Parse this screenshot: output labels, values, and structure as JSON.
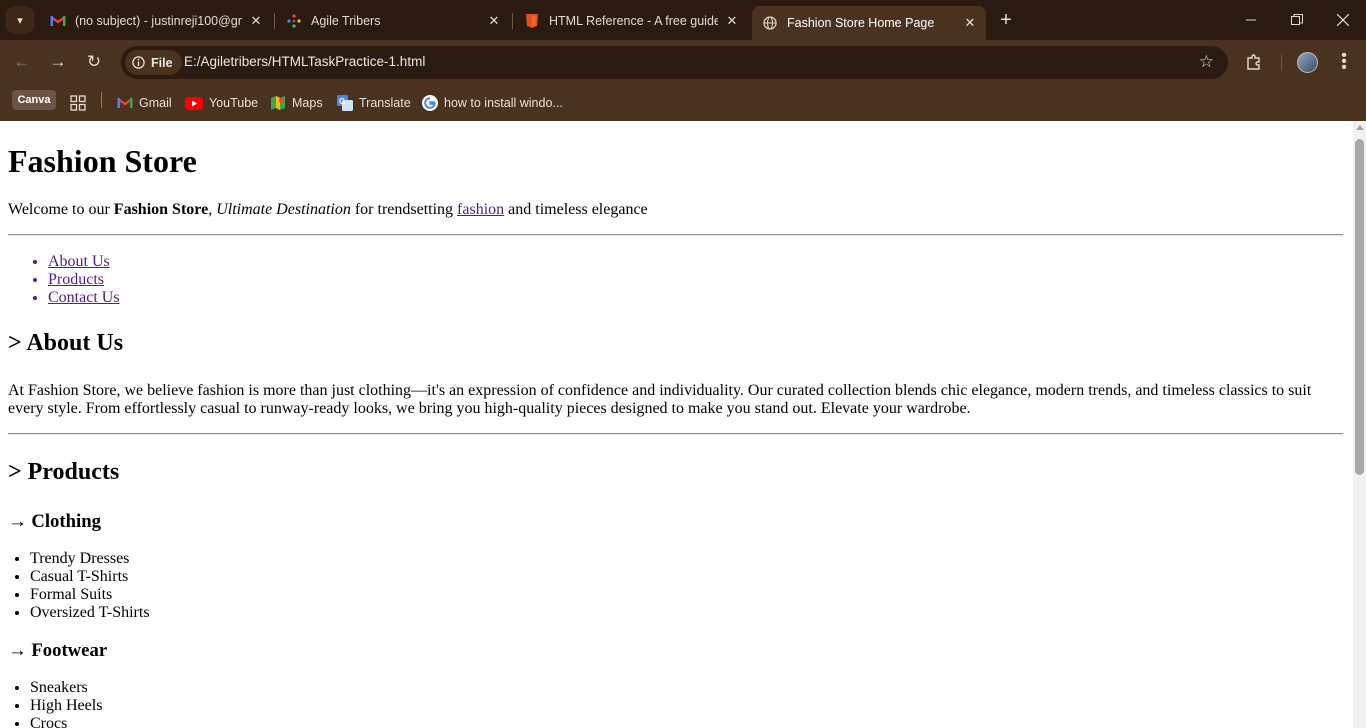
{
  "browser": {
    "tabs": [
      {
        "title": "(no subject) - justinreji100@gm",
        "icon": "gmail-icon"
      },
      {
        "title": "Agile Tribers",
        "icon": "agile-tribers-icon"
      },
      {
        "title": "HTML Reference - A free guide",
        "icon": "html-reference-icon"
      },
      {
        "title": "Fashion Store Home Page",
        "icon": "globe-icon"
      }
    ],
    "active_tab": 3,
    "address": {
      "chip_label": "File",
      "url": "E:/Agiletribers/HTMLTaskPractice-1.html"
    },
    "bookmarks": [
      {
        "label": "Canva"
      },
      {
        "label": "Gmail"
      },
      {
        "label": "YouTube"
      },
      {
        "label": "Maps"
      },
      {
        "label": "Translate"
      },
      {
        "label": "how to install windo..."
      }
    ],
    "colors": {
      "chrome_dark": "#2b1a0f",
      "chrome_mid": "#4a3220"
    }
  },
  "page": {
    "title": "Fashion Store",
    "intro": {
      "pre": "Welcome to our ",
      "bold": "Fashion Store",
      "comma": ", ",
      "italic": "Ultimate Destination",
      "mid": " for trendsetting ",
      "link": "fashion",
      "post": " and timeless elegance"
    },
    "nav": [
      "About Us",
      "Products",
      "Contact Us"
    ],
    "about": {
      "heading": "> About Us",
      "text": "At Fashion Store, we believe fashion is more than just clothing—it's an expression of confidence and individuality. Our curated collection blends chic elegance, modern trends, and timeless classics to suit every style. From effortlessly casual to runway-ready looks, we bring you high-quality pieces designed to make you stand out. Elevate your wardrobe."
    },
    "products": {
      "heading": "> Products",
      "categories": [
        {
          "title": "→ Clothing",
          "items": [
            "Trendy Dresses",
            "Casual T-Shirts",
            "Formal Suits",
            "Oversized T-Shirts"
          ]
        },
        {
          "title": "→ Footwear",
          "items": [
            "Sneakers",
            "High Heels",
            "Crocs"
          ]
        }
      ]
    },
    "link_color": "#551a8b"
  }
}
